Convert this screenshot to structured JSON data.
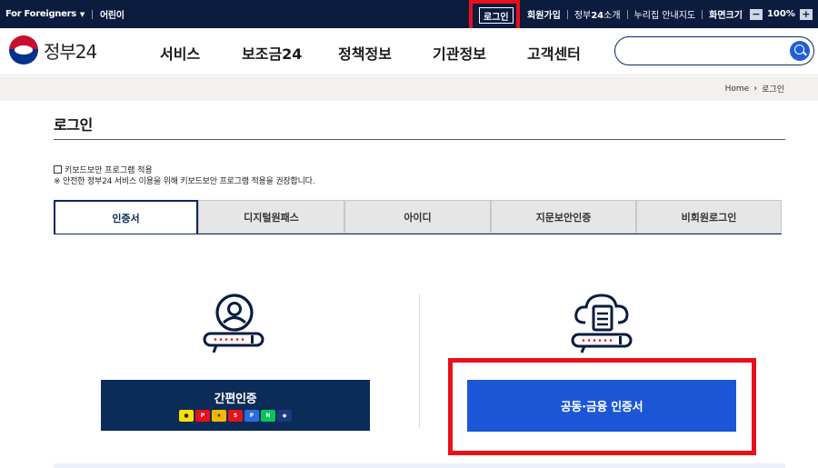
{
  "topbar": {
    "foreigners": "For Foreigners",
    "kids": "어린이",
    "login": "로그인",
    "signup": "회원가입",
    "intro_prefix": "정부",
    "intro_bold": "24",
    "intro_suffix": "소개",
    "guide": "누리집 안내지도",
    "screen_size_label": "화면크기",
    "zoom_out": "−",
    "zoom_value": "100%",
    "zoom_in": "+"
  },
  "header": {
    "logo_text": "정부24",
    "nav": [
      "서비스",
      "보조금24",
      "정책정보",
      "기관정보",
      "고객센터"
    ],
    "search_placeholder": ""
  },
  "breadcrumb": {
    "home": "Home",
    "current": "로그인"
  },
  "main": {
    "title": "로그인",
    "keyboard_security_label": "키보드보안 프로그램 적용",
    "keyboard_security_note": "※ 안전한 정부24 서비스 이용을 위해 키보드보안 프로그램 적용을 권장합니다.",
    "tabs": [
      {
        "label": "인증서",
        "active": true
      },
      {
        "label": "디지털원패스",
        "active": false
      },
      {
        "label": "아이디",
        "active": false
      },
      {
        "label": "지문보안인증",
        "active": false
      },
      {
        "label": "비회원로그인",
        "active": false
      }
    ],
    "easy_auth_label": "간편인증",
    "easy_auth_providers": [
      "kakao",
      "payco",
      "kb",
      "samsung",
      "pass",
      "naver",
      "shinhan"
    ],
    "joint_cert_label": "공동·금융 인증서"
  },
  "colors": {
    "topbar_bg": "#0b1c3f",
    "navy": "#0a2a5c",
    "blue_button": "#1a56d6",
    "highlight": "#e8101a"
  }
}
